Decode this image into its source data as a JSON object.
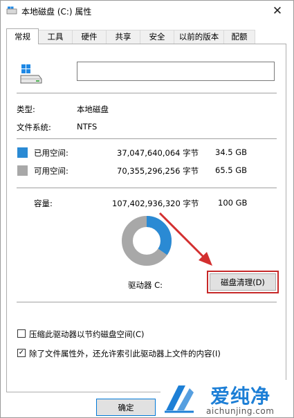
{
  "window": {
    "title": "本地磁盘 (C:) 属性",
    "close_glyph": "✕"
  },
  "tabs": [
    {
      "label": "常规",
      "active": true
    },
    {
      "label": "工具"
    },
    {
      "label": "硬件"
    },
    {
      "label": "共享"
    },
    {
      "label": "安全"
    },
    {
      "label": "以前的版本"
    },
    {
      "label": "配额"
    }
  ],
  "general": {
    "volume_name_value": "",
    "type_label": "类型:",
    "type_value": "本地磁盘",
    "fs_label": "文件系统:",
    "fs_value": "NTFS",
    "used_label": "已用空间:",
    "used_bytes": "37,047,640,064 字节",
    "used_gb": "34.5 GB",
    "free_label": "可用空间:",
    "free_bytes": "70,355,296,256 字节",
    "free_gb": "65.5 GB",
    "capacity_label": "容量:",
    "capacity_bytes": "107,402,936,320 字节",
    "capacity_gb": "100 GB",
    "drive_label": "驱动器 C:",
    "cleanup_button": "磁盘清理(D)",
    "used_fraction": 0.345
  },
  "options": {
    "compress_label": "压缩此驱动器以节约磁盘空间(C)",
    "compress_checked": false,
    "index_label": "除了文件属性外，还允许索引此驱动器上文件的内容(I)",
    "index_checked": true,
    "check_glyph": "✓"
  },
  "footer": {
    "ok_button": "确定"
  },
  "watermark": {
    "title": "爱纯净",
    "url": "aichunjing.com"
  },
  "colors": {
    "used": "#2a8ad4",
    "free": "#a8a8a8",
    "highlight": "#c62828",
    "brand": "#1d7fd6"
  },
  "icons": {
    "title": "drive-icon",
    "close": "close-icon",
    "drive": "windows-drive-icon",
    "arrow": "red-arrow-icon",
    "watermark": "aichunjing-logo-icon"
  }
}
